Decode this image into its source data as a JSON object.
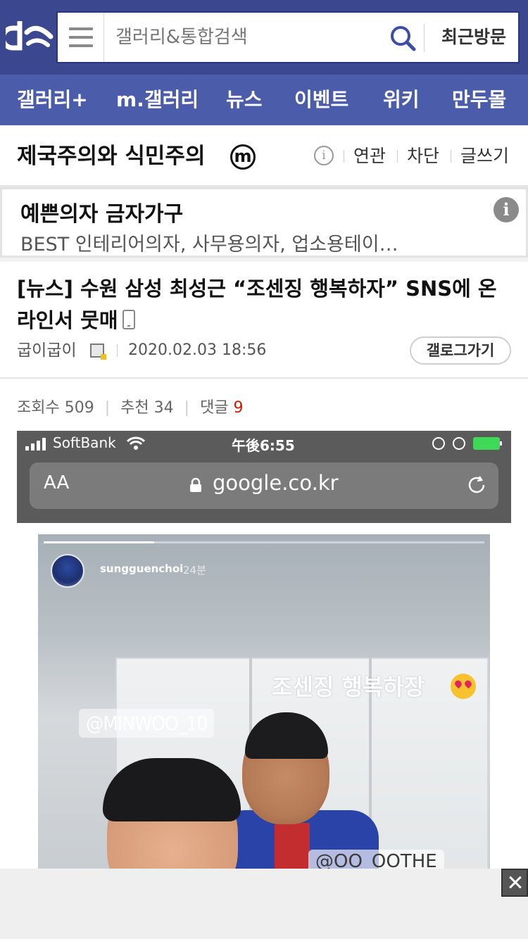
{
  "header": {
    "logo": "dc-logo-icon",
    "search": {
      "placeholder": "갤러리&통합검색",
      "recent_label": "최근방문"
    },
    "nav": [
      "갤러리+",
      "m.갤러리",
      "뉴스",
      "이벤트",
      "위키",
      "만두몰"
    ]
  },
  "gallery": {
    "title": "제국주의와 식민주의",
    "badge": "m",
    "info": "i",
    "links": [
      "연관",
      "차단",
      "글쓰기"
    ]
  },
  "ad": {
    "title": "예쁜의자 금자가구",
    "description": "BEST 인테리어의자, 사무용의자, 업소용테이…",
    "info": "i"
  },
  "article": {
    "title": "[뉴스] 수원 삼성 최성근 “조센징 행복하자” SNS에 온라인서 뭇매",
    "author": "굽이굽이",
    "date": "2020.02.03 18:56",
    "gallog_label": "갤로그가기",
    "stats": {
      "views_label": "조회수",
      "views": "509",
      "recommend_label": "추천",
      "recommend": "34",
      "comments_label": "댓글",
      "comments": "9"
    }
  },
  "embedded_screenshot": {
    "status_bar": {
      "carrier": "SoftBank",
      "time": "午後6:55"
    },
    "url_bar": {
      "text_size": "AA",
      "url": "google.co.kr"
    },
    "story": {
      "progress": 0.25,
      "username": "sungguenchoi",
      "time_ago": "24분",
      "caption": "조센징  행복하장",
      "mention1": "@MINWOO_10",
      "mention2": "@OO_OOTHE"
    }
  },
  "colors": {
    "header_bg": "#3b4890",
    "nav_bg": "#4b5cab",
    "comment_count": "#d31900"
  }
}
